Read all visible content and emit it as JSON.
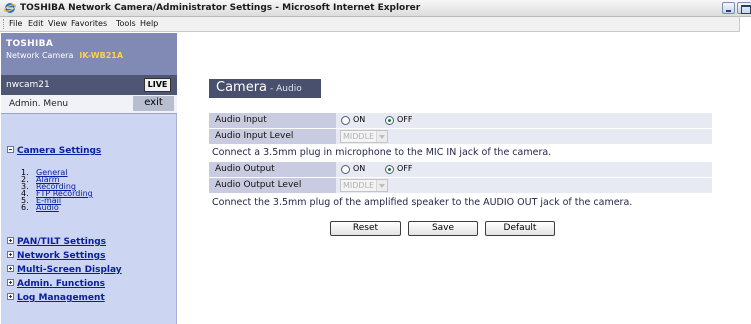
{
  "window": {
    "title": "TOSHIBA Network Camera/Administrator Settings - Microsoft Internet Explorer",
    "menu": [
      "File",
      "Edit",
      "View",
      "Favorites",
      "Tools",
      "Help"
    ]
  },
  "sidebar": {
    "brand": "TOSHIBA",
    "product": "Network Camera",
    "model": "IK-WB21A",
    "camera_name": "nwcam21",
    "live_label": "LIVE",
    "admin_menu_label": "Admin. Menu",
    "exit_label": "exit",
    "camera_settings": {
      "label": "Camera Settings",
      "items": [
        {
          "num": "1.",
          "label": "General"
        },
        {
          "num": "2.",
          "label": "Alarm"
        },
        {
          "num": "3.",
          "label": "Recording"
        },
        {
          "num": "4.",
          "label": "FTP Recording"
        },
        {
          "num": "5.",
          "label": "E-mail"
        },
        {
          "num": "6.",
          "label": "Audio"
        }
      ]
    },
    "sections": [
      "PAN/TILT Settings",
      "Network Settings",
      "Multi-Screen Display",
      "Admin. Functions",
      "Log Management"
    ]
  },
  "main": {
    "title": "Camera",
    "subtitle": "- Audio",
    "audio_input": {
      "label": "Audio Input",
      "on": "ON",
      "off": "OFF",
      "selected": "OFF"
    },
    "audio_input_level": {
      "label": "Audio Input Level",
      "value": "MIDDLE"
    },
    "input_note": "Connect a 3.5mm plug in microphone to the MIC IN jack of the camera.",
    "audio_output": {
      "label": "Audio Output",
      "on": "ON",
      "off": "OFF",
      "selected": "OFF"
    },
    "audio_output_level": {
      "label": "Audio Output Level",
      "value": "MIDDLE"
    },
    "output_note": "Connect the 3.5mm plug of the amplified speaker to the AUDIO OUT jack of the camera.",
    "buttons": {
      "reset": "Reset",
      "save": "Save",
      "default": "Default"
    }
  },
  "colors": {
    "sidebar_bg": "#ccd6f2",
    "brand_bg": "#808ab5",
    "header_bg": "#49506d",
    "link": "#0a1f9c",
    "model": "#ffd24a"
  }
}
